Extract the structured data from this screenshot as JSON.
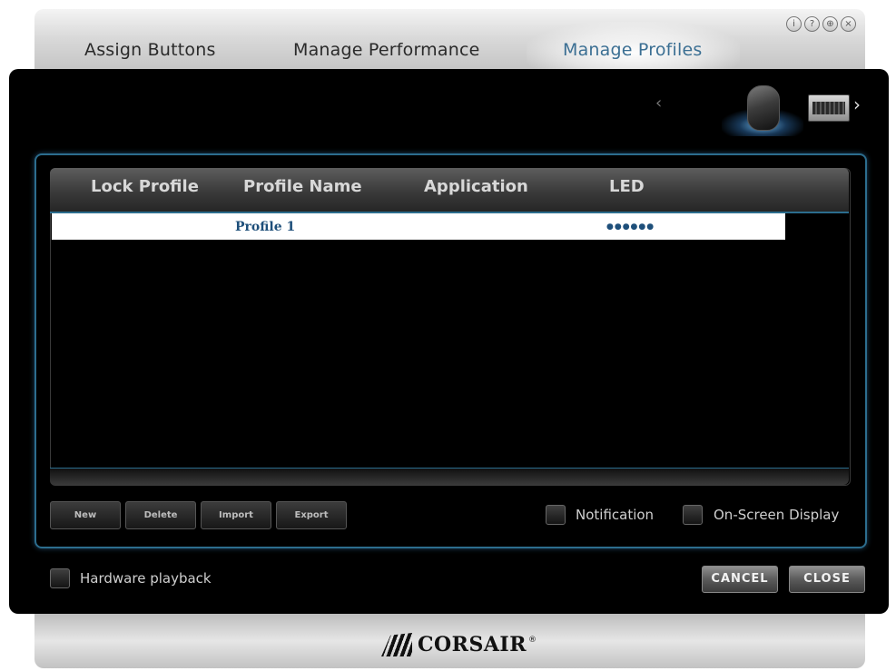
{
  "tabs": [
    {
      "label": "Assign Buttons"
    },
    {
      "label": "Manage Performance"
    },
    {
      "label": "Manage Profiles",
      "active": true
    }
  ],
  "window_icons": [
    "info-icon",
    "help-icon",
    "globe-icon",
    "close-icon"
  ],
  "window_icon_glyphs": [
    "i",
    "?",
    "⊕",
    "×"
  ],
  "device_nav": {
    "prev": "‹",
    "next": "›"
  },
  "table": {
    "columns": [
      "Lock Profile",
      "Profile Name",
      "Application",
      "LED"
    ],
    "rows": [
      {
        "lock": "",
        "name": "Profile 1",
        "application": "",
        "led": "●●●●●●"
      }
    ]
  },
  "buttons": {
    "new": "New",
    "delete": "Delete",
    "import": "Import",
    "export": "Export"
  },
  "checkboxes": {
    "notification": {
      "label": "Notification",
      "checked": false
    },
    "osd": {
      "label": "On-Screen Display",
      "checked": false
    },
    "hardware_playback": {
      "label": "Hardware playback",
      "checked": false
    }
  },
  "actions": {
    "cancel": "CANCEL",
    "close": "CLOSE"
  },
  "brand": {
    "name": "CORSAIR",
    "mark": "®"
  },
  "colors": {
    "accent": "#2c6d8e",
    "active_tab": "#3b6f93",
    "background": "#000000"
  }
}
